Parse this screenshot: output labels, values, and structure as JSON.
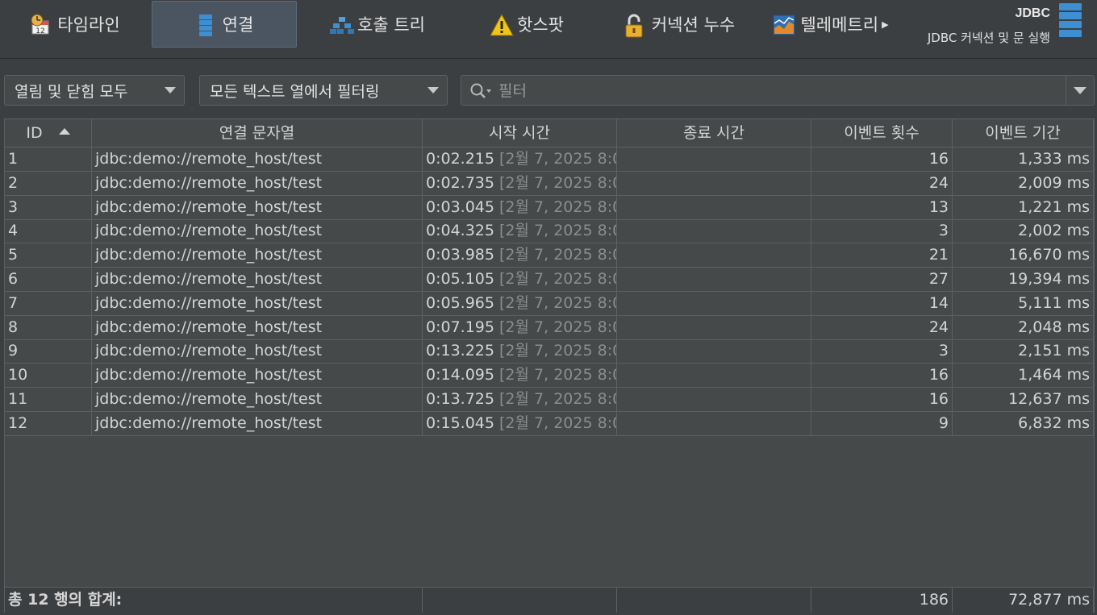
{
  "tabs": [
    {
      "label": "타임라인",
      "icon": "calendar-clock-icon"
    },
    {
      "label": "연결",
      "icon": "database-stack-icon",
      "active": true
    },
    {
      "label": "호출 트리",
      "icon": "call-tree-icon"
    },
    {
      "label": "핫스팟",
      "icon": "warning-icon"
    },
    {
      "label": "커넥션 누수",
      "icon": "padlock-icon"
    },
    {
      "label": "텔레메트리",
      "icon": "telemetry-chart-icon"
    }
  ],
  "section": {
    "title": "JDBC",
    "subtitle": "JDBC 커넥션 및 문 실행"
  },
  "filters": {
    "state_select": "열림 및 닫힘 모두",
    "column_select": "모든 텍스트 열에서 필터링",
    "search_placeholder": "필터"
  },
  "table": {
    "columns": [
      "ID",
      "연결 문자열",
      "시작 시간",
      "종료 시간",
      "이벤트 횟수",
      "이벤트 기간"
    ],
    "rows": [
      {
        "id": "1",
        "conn": "jdbc:demo://remote_host/test",
        "start": "0:02.215",
        "date": " [2월 7, 2025 8:0..",
        "end": "",
        "count": "16",
        "dur": "1,333 ms"
      },
      {
        "id": "2",
        "conn": "jdbc:demo://remote_host/test",
        "start": "0:02.735",
        "date": " [2월 7, 2025 8:0..",
        "end": "",
        "count": "24",
        "dur": "2,009 ms"
      },
      {
        "id": "3",
        "conn": "jdbc:demo://remote_host/test",
        "start": "0:03.045",
        "date": " [2월 7, 2025 8:0..",
        "end": "",
        "count": "13",
        "dur": "1,221 ms"
      },
      {
        "id": "4",
        "conn": "jdbc:demo://remote_host/test",
        "start": "0:04.325",
        "date": " [2월 7, 2025 8:0..",
        "end": "",
        "count": "3",
        "dur": "2,002 ms"
      },
      {
        "id": "5",
        "conn": "jdbc:demo://remote_host/test",
        "start": "0:03.985",
        "date": " [2월 7, 2025 8:0..",
        "end": "",
        "count": "21",
        "dur": "16,670 ms"
      },
      {
        "id": "6",
        "conn": "jdbc:demo://remote_host/test",
        "start": "0:05.105",
        "date": " [2월 7, 2025 8:0..",
        "end": "",
        "count": "27",
        "dur": "19,394 ms"
      },
      {
        "id": "7",
        "conn": "jdbc:demo://remote_host/test",
        "start": "0:05.965",
        "date": " [2월 7, 2025 8:0..",
        "end": "",
        "count": "14",
        "dur": "5,111 ms"
      },
      {
        "id": "8",
        "conn": "jdbc:demo://remote_host/test",
        "start": "0:07.195",
        "date": " [2월 7, 2025 8:0..",
        "end": "",
        "count": "24",
        "dur": "2,048 ms"
      },
      {
        "id": "9",
        "conn": "jdbc:demo://remote_host/test",
        "start": "0:13.225",
        "date": " [2월 7, 2025 8:0..",
        "end": "",
        "count": "3",
        "dur": "2,151 ms"
      },
      {
        "id": "10",
        "conn": "jdbc:demo://remote_host/test",
        "start": "0:14.095",
        "date": " [2월 7, 2025 8:0..",
        "end": "",
        "count": "16",
        "dur": "1,464 ms"
      },
      {
        "id": "11",
        "conn": "jdbc:demo://remote_host/test",
        "start": "0:13.725",
        "date": " [2월 7, 2025 8:0..",
        "end": "",
        "count": "16",
        "dur": "12,637 ms"
      },
      {
        "id": "12",
        "conn": "jdbc:demo://remote_host/test",
        "start": "0:15.045",
        "date": " [2월 7, 2025 8:0..",
        "end": "",
        "count": "9",
        "dur": "6,832 ms"
      }
    ],
    "footer": {
      "label": "총 12 행의 합계:",
      "count": "186",
      "dur": "72,877 ms"
    }
  },
  "colors": {
    "background": "#3c3f41",
    "panel": "#45494a",
    "active_tab": "#4b5561",
    "accent_blue": "#3d8fd1"
  }
}
